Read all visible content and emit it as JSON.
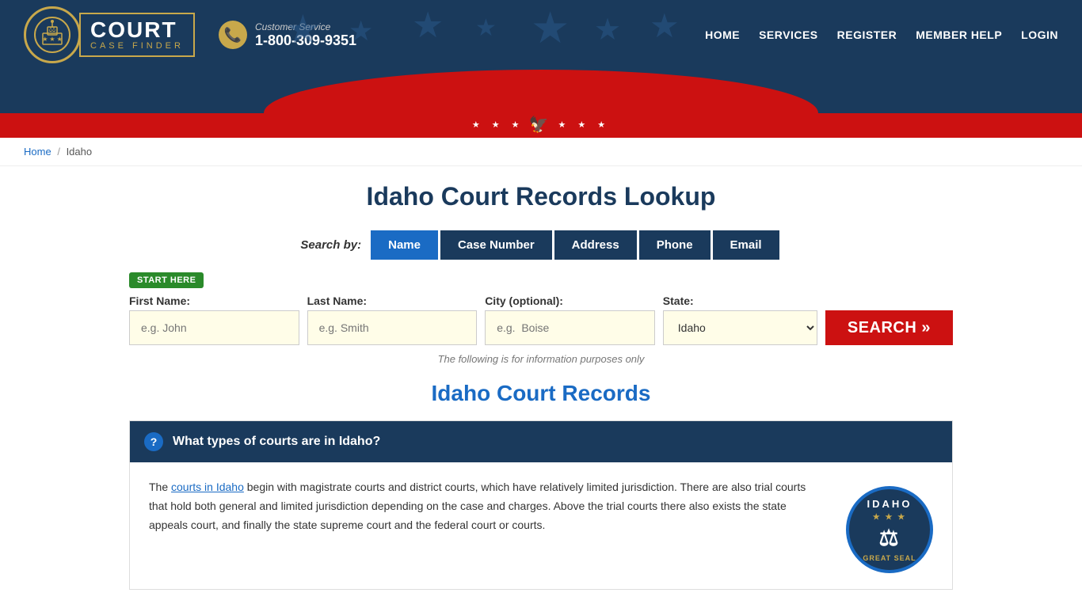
{
  "header": {
    "logo": {
      "court_label": "COURT",
      "case_finder_label": "CASE FINDER"
    },
    "customer_service": {
      "label": "Customer Service",
      "phone": "1-800-309-9351"
    },
    "nav": {
      "items": [
        {
          "label": "HOME",
          "href": "#"
        },
        {
          "label": "SERVICES",
          "href": "#"
        },
        {
          "label": "REGISTER",
          "href": "#"
        },
        {
          "label": "MEMBER HELP",
          "href": "#"
        },
        {
          "label": "LOGIN",
          "href": "#"
        }
      ]
    }
  },
  "breadcrumb": {
    "home_label": "Home",
    "separator": "/",
    "current": "Idaho"
  },
  "main": {
    "page_title": "Idaho Court Records Lookup",
    "search_by_label": "Search by:",
    "tabs": [
      {
        "label": "Name",
        "active": true
      },
      {
        "label": "Case Number",
        "active": false
      },
      {
        "label": "Address",
        "active": false
      },
      {
        "label": "Phone",
        "active": false
      },
      {
        "label": "Email",
        "active": false
      }
    ],
    "start_here_badge": "START HERE",
    "form": {
      "first_name_label": "First Name:",
      "first_name_placeholder": "e.g. John",
      "last_name_label": "Last Name:",
      "last_name_placeholder": "e.g. Smith",
      "city_label": "City (optional):",
      "city_placeholder": "e.g.  Boise",
      "state_label": "State:",
      "state_value": "Idaho",
      "search_btn_label": "SEARCH »"
    },
    "info_note": "The following is for information purposes only",
    "section_title": "Idaho Court Records",
    "accordion": {
      "question": "What types of courts are in Idaho?",
      "body_text_1": "The ",
      "body_link_text": "courts in Idaho",
      "body_text_2": " begin with magistrate courts and district courts, which have relatively limited jurisdiction. There are also trial courts that hold both general and limited jurisdiction depending on the case and charges. Above the trial courts there also exists the state appeals court, and finally the state supreme court and the federal court or courts.",
      "seal_name": "IDAHO",
      "seal_stars": "★ ★ ★"
    }
  },
  "eagle_bar": {
    "stars_left": "★ ★ ★",
    "eagle": "🦅",
    "stars_right": "★ ★ ★"
  }
}
